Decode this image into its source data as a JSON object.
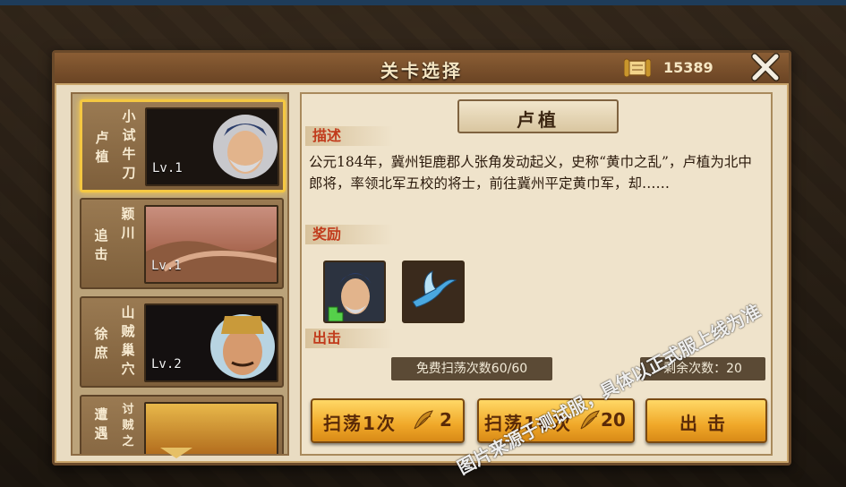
{
  "window": {
    "title": "关卡选择",
    "gold": "15389"
  },
  "stages": [
    {
      "title": "小试牛刀",
      "subtitle": "卢植",
      "level": "Lv.1"
    },
    {
      "title": "颖川",
      "subtitle": "追击",
      "level": "Lv.1"
    },
    {
      "title": "山贼巢穴",
      "subtitle": "徐庶",
      "level": "Lv.2"
    },
    {
      "title": "讨贼之",
      "subtitle": "遭遇",
      "level": ""
    }
  ],
  "detail": {
    "name": "卢植",
    "desc_label": "描述",
    "description": "公元184年，冀州钜鹿郡人张角发动起义，史称“黄巾之乱”，卢植为北中郎将，率领北军五校的将士，前往冀州平定黄巾军，却……",
    "reward_label": "奖励",
    "attack_label": "出击",
    "free_sweep": "免费扫荡次数60/60",
    "remaining": "剩余次数：20"
  },
  "buttons": {
    "sweep1_label": "扫荡1次",
    "sweep1_cost": "2",
    "sweep10_label": "扫荡10次",
    "sweep10_cost": "20",
    "attack_label": "出 击"
  },
  "watermark": "图片来源于测试服，具体以正式服上线为准",
  "colors": {
    "accent_gold": "#f5c842",
    "label_red": "#c13b1c",
    "panel_brown": "#6b4a2a"
  }
}
